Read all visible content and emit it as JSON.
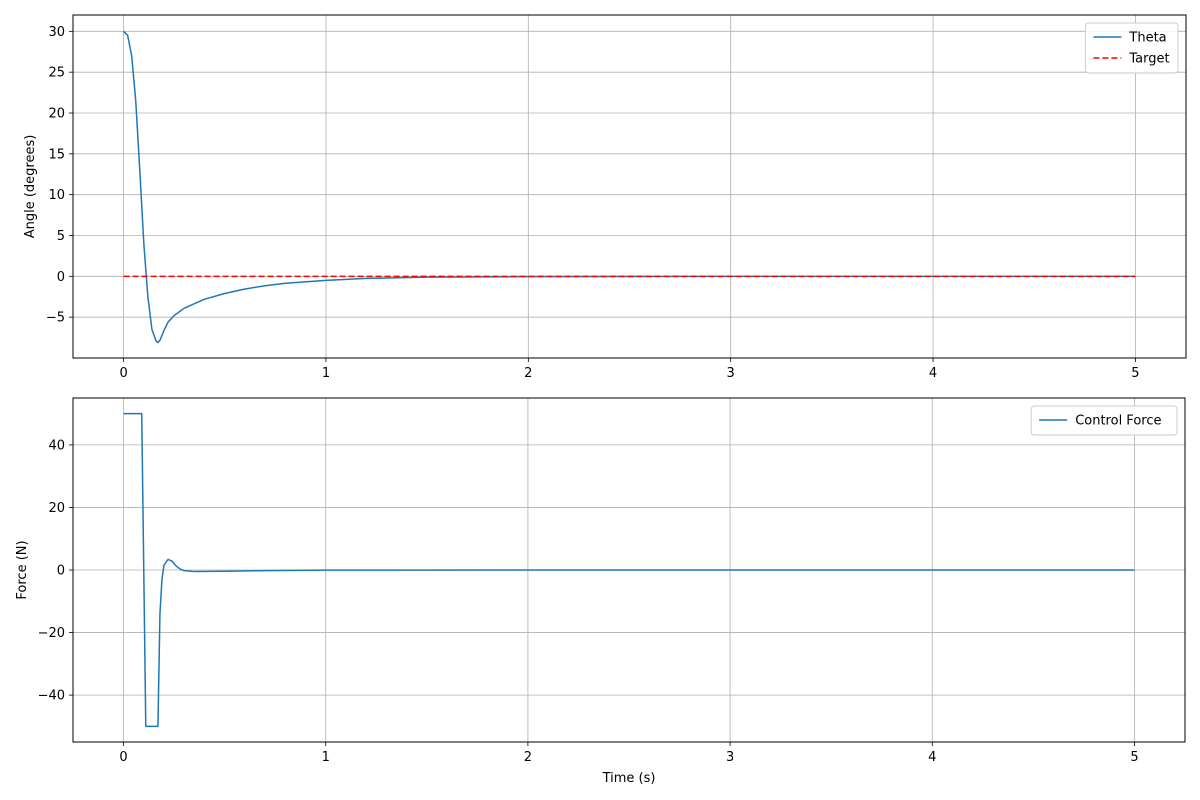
{
  "chart_data": [
    {
      "type": "line",
      "title": "",
      "xlabel": "",
      "ylabel": "Angle (degrees)",
      "xlim": [
        -0.25,
        5.25
      ],
      "ylim": [
        -10,
        32
      ],
      "xticks": [
        0,
        1,
        2,
        3,
        4,
        5
      ],
      "yticks": [
        -5,
        0,
        5,
        10,
        15,
        20,
        25,
        30
      ],
      "grid": true,
      "legend_position": "upper right",
      "series": [
        {
          "name": "Theta",
          "color": "#1f77b4",
          "style": "solid",
          "x": [
            0,
            0.02,
            0.04,
            0.06,
            0.08,
            0.1,
            0.12,
            0.14,
            0.16,
            0.17,
            0.18,
            0.2,
            0.22,
            0.25,
            0.3,
            0.4,
            0.5,
            0.6,
            0.7,
            0.8,
            1.0,
            1.2,
            1.5,
            2.0,
            3.0,
            4.0,
            5.0
          ],
          "y": [
            30,
            29.5,
            27,
            21.5,
            13,
            4,
            -2.5,
            -6.5,
            -7.9,
            -8.1,
            -7.8,
            -6.6,
            -5.6,
            -4.8,
            -3.9,
            -2.8,
            -2.1,
            -1.55,
            -1.15,
            -0.85,
            -0.5,
            -0.25,
            -0.1,
            -0.03,
            0,
            0,
            0
          ]
        },
        {
          "name": "Target",
          "color": "#ff0000",
          "style": "dashed",
          "x": [
            0,
            5
          ],
          "y": [
            0,
            0
          ]
        }
      ]
    },
    {
      "type": "line",
      "title": "",
      "xlabel": "Time (s)",
      "ylabel": "Force (N)",
      "xlim": [
        -0.25,
        5.25
      ],
      "ylim": [
        -55,
        55
      ],
      "xticks": [
        0,
        1,
        2,
        3,
        4,
        5
      ],
      "yticks": [
        -40,
        -20,
        0,
        20,
        40
      ],
      "grid": true,
      "legend_position": "upper right",
      "series": [
        {
          "name": "Control Force",
          "color": "#1f77b4",
          "style": "solid",
          "x": [
            0,
            0.09,
            0.1,
            0.11,
            0.17,
            0.18,
            0.19,
            0.2,
            0.22,
            0.24,
            0.26,
            0.28,
            0.3,
            0.35,
            0.5,
            0.7,
            1.0,
            2.0,
            3.0,
            4.0,
            5.0
          ],
          "y": [
            50,
            50,
            0,
            -50,
            -50,
            -14,
            -3,
            1.5,
            3.4,
            2.8,
            1.3,
            0.3,
            -0.2,
            -0.5,
            -0.4,
            -0.2,
            -0.05,
            0,
            0,
            0,
            0
          ]
        }
      ]
    }
  ]
}
